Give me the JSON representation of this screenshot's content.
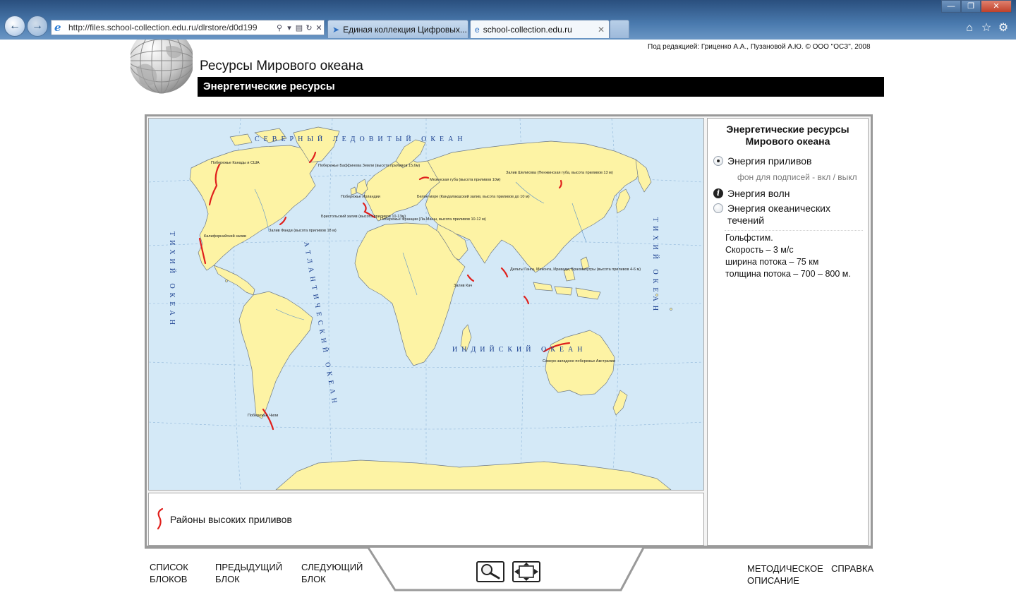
{
  "browser": {
    "address": "http://files.school-collection.edu.ru/dlrstore/d0d199",
    "tabs": [
      {
        "label": "Единая коллекция Цифровых..."
      },
      {
        "label": "school-collection.edu.ru"
      }
    ]
  },
  "header": {
    "credits": "Под редакцией: Гриценко А.А., Пузановой А.Ю. © ООО \"ОСЗ\", 2008",
    "title": "Ресурсы Мирового океана",
    "section": "Энергетические ресурсы"
  },
  "map": {
    "oceans": {
      "arctic": "СЕВЕРНЫЙ  ЛЕДОВИТЫЙ  ОКЕАН",
      "atlantic": "АТЛАНТИЧЕСКИЙ ОКЕАН",
      "indian": "ИНДИЙСКИЙ  ОКЕАН",
      "pacific_e": "ТИХИЙ  ОКЕАН",
      "pacific_w": "ТИХИЙ  ОКЕАН"
    },
    "labels": [
      "Побережье Канады и США",
      "Побережье Баффинова Земли (высота приливов 15,6м)",
      "Побережье Ирландии",
      "Бристольский залив (высота приливов 10-13м)",
      "Залив Фанди (высота приливов 18 м)",
      "Калифорнийский залив",
      "Побережье Франции (Ла-Манш, высота приливов 10-12 м)",
      "Мезенская губа (высота приливов 10м)",
      "Белое море (Кандалакшский залив, высота приливов до 10 м)",
      "Залив Шелихова (Пенжинская губа, высота приливов 13 м)",
      "Залив Кач",
      "Дельты Ганга, Меконга, Иравади, Брахмапутры (высота приливов 4-6 м)",
      "Северо-западное побережье Австралии",
      "Побережье Чили"
    ]
  },
  "legend": {
    "label": "Районы высоких приливов"
  },
  "side": {
    "title": "Энергетические ресурсы Мирового океана",
    "options": [
      {
        "label": "Энергия приливов",
        "selected": true
      },
      {
        "label": "Энергия волн",
        "icon": "info-icon"
      },
      {
        "label": "Энергия океанических течений",
        "selected": false
      }
    ],
    "bg_toggle": "фон для подписей - вкл / выкл",
    "info": [
      "Гольфстим.",
      "Скорость – 3 м/с",
      "ширина потока – 75 км",
      "толщина потока – 700 – 800 м."
    ]
  },
  "nav": {
    "list": [
      "СПИСОК",
      "БЛОКОВ"
    ],
    "prev": [
      "ПРЕДЫДУЩИЙ",
      "БЛОК"
    ],
    "next": [
      "СЛЕДУЮЩИЙ",
      "БЛОК"
    ],
    "method": [
      "МЕТОДИЧЕСКОЕ",
      "ОПИСАНИЕ"
    ],
    "help": "СПРАВКА"
  },
  "colors": {
    "land": "#fdf3a4",
    "sea": "#d4e9f7",
    "tide": "#e0201c",
    "ocean_text": "#1a3f8f"
  }
}
